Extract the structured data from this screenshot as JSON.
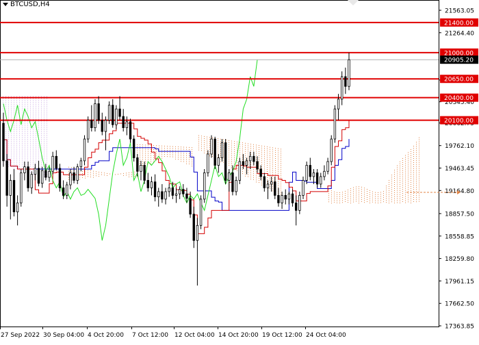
{
  "chart_data": {
    "type": "candlestick",
    "symbol": "BTCUSD,H4",
    "y_axis": {
      "ticks": [
        21563.05,
        21264.4,
        20635.4,
        20345.4,
        20062.75,
        19762.1,
        19463.45,
        19164.8,
        18857.5,
        18558.85,
        18259.8,
        17961.15,
        17662.5,
        17363.85
      ],
      "tick_labels": [
        "21563.05",
        "21264.40",
        "20635.40",
        "20345.40",
        "20062.75",
        "19762.10",
        "19463.45",
        "19164.80",
        "18857.50",
        "18558.85",
        "18259.80",
        "17961.15",
        "17662.50",
        "17363.85"
      ],
      "ylim": [
        17363.85,
        21563.05
      ]
    },
    "x_axis": {
      "tick_labels": [
        "27 Sep 2022",
        "30 Sep 04:00",
        "4 Oct 20:00",
        "7 Oct 12:00",
        "12 Oct 04:00",
        "14 Oct 20:00",
        "19 Oct 12:00",
        "24 Oct 04:00"
      ]
    },
    "horizontal_levels": [
      {
        "value": 21400.0,
        "label": "21400.00",
        "color": "#e00000"
      },
      {
        "value": 21000.0,
        "label": "21000.00",
        "color": "#e00000"
      },
      {
        "value": 20650.0,
        "label": "20650.00",
        "color": "#e00000"
      },
      {
        "value": 20400.0,
        "label": "20400.00",
        "color": "#e00000"
      },
      {
        "value": 20100.0,
        "label": "20100.00",
        "color": "#e00000"
      }
    ],
    "current_price": {
      "value": 20905.2,
      "label": "20905.20"
    },
    "indicators": {
      "tenkan_color": "#d40000",
      "kijun_color": "#0000c8",
      "chikou_color": "#22dd22",
      "cloud_color": "#e08040",
      "cloud_alt_color": "#c8a8e0"
    },
    "candles": [
      {
        "o": 20060,
        "h": 20200,
        "l": 19480,
        "c": 19560
      },
      {
        "o": 19560,
        "h": 19650,
        "l": 18950,
        "c": 19100
      },
      {
        "o": 19100,
        "h": 19380,
        "l": 18780,
        "c": 19300
      },
      {
        "o": 19300,
        "h": 19450,
        "l": 18820,
        "c": 18880
      },
      {
        "o": 18880,
        "h": 19100,
        "l": 18700,
        "c": 19000
      },
      {
        "o": 19000,
        "h": 19450,
        "l": 18950,
        "c": 19400
      },
      {
        "o": 19400,
        "h": 19550,
        "l": 19300,
        "c": 19480
      },
      {
        "o": 19480,
        "h": 19550,
        "l": 19150,
        "c": 19200
      },
      {
        "o": 19200,
        "h": 19420,
        "l": 19120,
        "c": 19380
      },
      {
        "o": 19380,
        "h": 19520,
        "l": 19300,
        "c": 19460
      },
      {
        "o": 19460,
        "h": 19560,
        "l": 19220,
        "c": 19260
      },
      {
        "o": 19260,
        "h": 19480,
        "l": 19200,
        "c": 19430
      },
      {
        "o": 19430,
        "h": 19520,
        "l": 19300,
        "c": 19340
      },
      {
        "o": 19340,
        "h": 19480,
        "l": 19280,
        "c": 19420
      },
      {
        "o": 19420,
        "h": 19680,
        "l": 19380,
        "c": 19620
      },
      {
        "o": 19620,
        "h": 19700,
        "l": 19430,
        "c": 19460
      },
      {
        "o": 19460,
        "h": 19520,
        "l": 19150,
        "c": 19200
      },
      {
        "o": 19200,
        "h": 19300,
        "l": 19050,
        "c": 19100
      },
      {
        "o": 19100,
        "h": 19280,
        "l": 19050,
        "c": 19240
      },
      {
        "o": 19240,
        "h": 19450,
        "l": 19180,
        "c": 19400
      },
      {
        "o": 19400,
        "h": 19480,
        "l": 19260,
        "c": 19300
      },
      {
        "o": 19300,
        "h": 19520,
        "l": 19250,
        "c": 19480
      },
      {
        "o": 19480,
        "h": 19600,
        "l": 19420,
        "c": 19560
      },
      {
        "o": 19560,
        "h": 19900,
        "l": 19500,
        "c": 19850
      },
      {
        "o": 19850,
        "h": 20150,
        "l": 19800,
        "c": 20100
      },
      {
        "o": 20100,
        "h": 20300,
        "l": 19950,
        "c": 20000
      },
      {
        "o": 20000,
        "h": 20380,
        "l": 19950,
        "c": 20320
      },
      {
        "o": 20320,
        "h": 20420,
        "l": 20050,
        "c": 20100
      },
      {
        "o": 20100,
        "h": 20200,
        "l": 19900,
        "c": 19950
      },
      {
        "o": 19950,
        "h": 20150,
        "l": 19700,
        "c": 20100
      },
      {
        "o": 20100,
        "h": 20350,
        "l": 20050,
        "c": 20300
      },
      {
        "o": 20300,
        "h": 20380,
        "l": 20000,
        "c": 20040
      },
      {
        "o": 20040,
        "h": 20300,
        "l": 19980,
        "c": 20250
      },
      {
        "o": 20250,
        "h": 20420,
        "l": 20100,
        "c": 20150
      },
      {
        "o": 20150,
        "h": 20250,
        "l": 19950,
        "c": 20000
      },
      {
        "o": 20000,
        "h": 20150,
        "l": 19900,
        "c": 20080
      },
      {
        "o": 20080,
        "h": 20120,
        "l": 19800,
        "c": 19850
      },
      {
        "o": 19850,
        "h": 19900,
        "l": 19550,
        "c": 19600
      },
      {
        "o": 19600,
        "h": 19650,
        "l": 19350,
        "c": 19420
      },
      {
        "o": 19420,
        "h": 19560,
        "l": 19300,
        "c": 19500
      },
      {
        "o": 19500,
        "h": 19550,
        "l": 19250,
        "c": 19300
      },
      {
        "o": 19300,
        "h": 19400,
        "l": 19150,
        "c": 19200
      },
      {
        "o": 19200,
        "h": 19350,
        "l": 19100,
        "c": 19280
      },
      {
        "o": 19280,
        "h": 19380,
        "l": 19020,
        "c": 19080
      },
      {
        "o": 19080,
        "h": 19200,
        "l": 18950,
        "c": 19150
      },
      {
        "o": 19150,
        "h": 19250,
        "l": 19000,
        "c": 19050
      },
      {
        "o": 19050,
        "h": 19200,
        "l": 18980,
        "c": 19150
      },
      {
        "o": 19150,
        "h": 19250,
        "l": 19080,
        "c": 19200
      },
      {
        "o": 19200,
        "h": 19280,
        "l": 19050,
        "c": 19100
      },
      {
        "o": 19100,
        "h": 19200,
        "l": 19000,
        "c": 19120
      },
      {
        "o": 19120,
        "h": 19220,
        "l": 19050,
        "c": 19180
      },
      {
        "o": 19180,
        "h": 19250,
        "l": 19080,
        "c": 19120
      },
      {
        "o": 19120,
        "h": 19200,
        "l": 19000,
        "c": 19060
      },
      {
        "o": 19060,
        "h": 19150,
        "l": 18800,
        "c": 18850
      },
      {
        "o": 18850,
        "h": 18950,
        "l": 18400,
        "c": 18500
      },
      {
        "o": 18500,
        "h": 18800,
        "l": 17900,
        "c": 18700
      },
      {
        "o": 18700,
        "h": 19100,
        "l": 18650,
        "c": 19050
      },
      {
        "o": 19050,
        "h": 19450,
        "l": 19000,
        "c": 19400
      },
      {
        "o": 19400,
        "h": 19700,
        "l": 19350,
        "c": 19650
      },
      {
        "o": 19650,
        "h": 19900,
        "l": 19600,
        "c": 19850
      },
      {
        "o": 19850,
        "h": 19880,
        "l": 19450,
        "c": 19500
      },
      {
        "o": 19500,
        "h": 19650,
        "l": 19400,
        "c": 19600
      },
      {
        "o": 19600,
        "h": 19850,
        "l": 19550,
        "c": 19800
      },
      {
        "o": 19800,
        "h": 19850,
        "l": 19250,
        "c": 19300
      },
      {
        "o": 19300,
        "h": 19450,
        "l": 19150,
        "c": 19400
      },
      {
        "o": 19400,
        "h": 19500,
        "l": 19100,
        "c": 19150
      },
      {
        "o": 19150,
        "h": 19350,
        "l": 19100,
        "c": 19300
      },
      {
        "o": 19300,
        "h": 19600,
        "l": 19250,
        "c": 19550
      },
      {
        "o": 19550,
        "h": 19650,
        "l": 19450,
        "c": 19500
      },
      {
        "o": 19500,
        "h": 19600,
        "l": 19380,
        "c": 19560
      },
      {
        "o": 19560,
        "h": 19680,
        "l": 19450,
        "c": 19620
      },
      {
        "o": 19620,
        "h": 19680,
        "l": 19500,
        "c": 19550
      },
      {
        "o": 19550,
        "h": 19620,
        "l": 19400,
        "c": 19450
      },
      {
        "o": 19450,
        "h": 19500,
        "l": 19300,
        "c": 19350
      },
      {
        "o": 19350,
        "h": 19400,
        "l": 19150,
        "c": 19200
      },
      {
        "o": 19200,
        "h": 19300,
        "l": 19050,
        "c": 19250
      },
      {
        "o": 19250,
        "h": 19350,
        "l": 19150,
        "c": 19280
      },
      {
        "o": 19280,
        "h": 19350,
        "l": 19050,
        "c": 19100
      },
      {
        "o": 19100,
        "h": 19200,
        "l": 18950,
        "c": 19000
      },
      {
        "o": 19000,
        "h": 19150,
        "l": 18920,
        "c": 19100
      },
      {
        "o": 19100,
        "h": 19180,
        "l": 18980,
        "c": 19050
      },
      {
        "o": 19050,
        "h": 19150,
        "l": 18980,
        "c": 19120
      },
      {
        "o": 19120,
        "h": 19180,
        "l": 18950,
        "c": 19000
      },
      {
        "o": 19000,
        "h": 19100,
        "l": 18700,
        "c": 18900
      },
      {
        "o": 18900,
        "h": 19150,
        "l": 18850,
        "c": 19100
      },
      {
        "o": 19100,
        "h": 19350,
        "l": 19050,
        "c": 19300
      },
      {
        "o": 19300,
        "h": 19550,
        "l": 19250,
        "c": 19500
      },
      {
        "o": 19500,
        "h": 19600,
        "l": 19300,
        "c": 19350
      },
      {
        "o": 19350,
        "h": 19450,
        "l": 19250,
        "c": 19400
      },
      {
        "o": 19400,
        "h": 19450,
        "l": 19200,
        "c": 19250
      },
      {
        "o": 19250,
        "h": 19400,
        "l": 19200,
        "c": 19350
      },
      {
        "o": 19350,
        "h": 19500,
        "l": 19300,
        "c": 19420
      },
      {
        "o": 19420,
        "h": 19600,
        "l": 19380,
        "c": 19550
      },
      {
        "o": 19550,
        "h": 19900,
        "l": 19500,
        "c": 19850
      },
      {
        "o": 19850,
        "h": 20300,
        "l": 19800,
        "c": 20250
      },
      {
        "o": 20250,
        "h": 20450,
        "l": 20100,
        "c": 20380
      },
      {
        "o": 20380,
        "h": 20750,
        "l": 20300,
        "c": 20680
      },
      {
        "o": 20680,
        "h": 20800,
        "l": 20450,
        "c": 20550
      },
      {
        "o": 20550,
        "h": 21000,
        "l": 20500,
        "c": 20905
      }
    ]
  }
}
